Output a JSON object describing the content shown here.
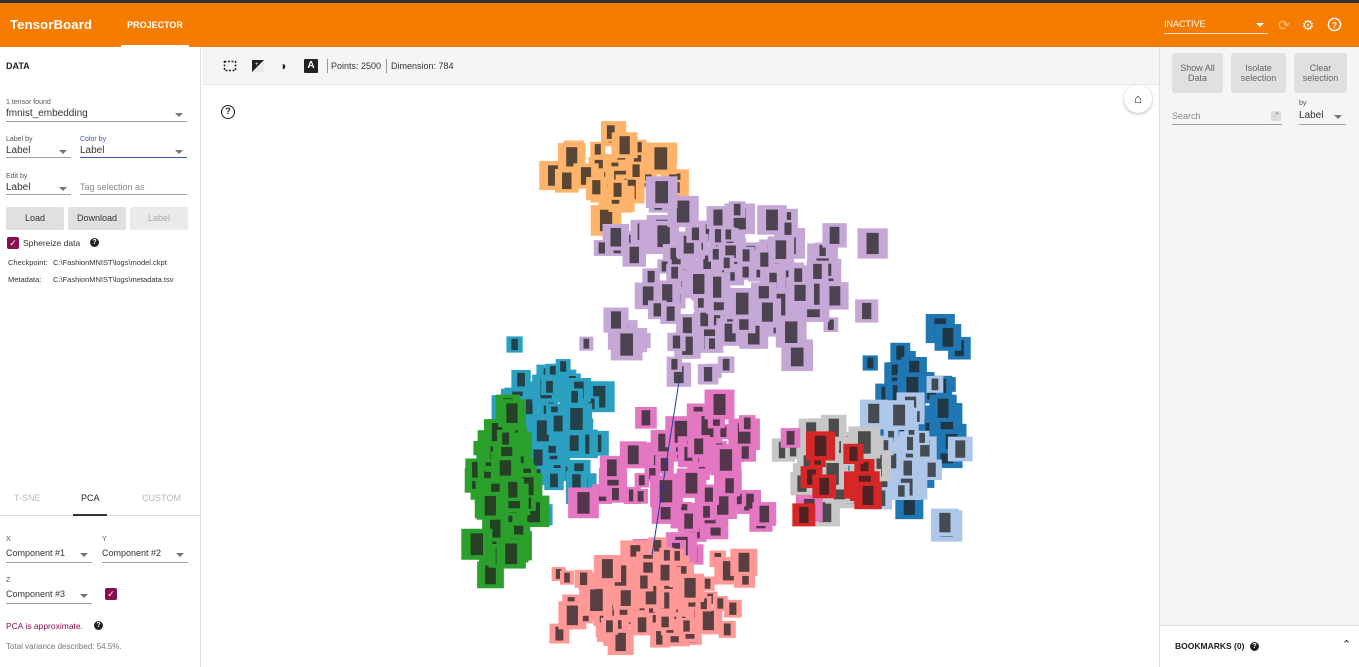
{
  "header": {
    "brand": "TensorBoard",
    "tab_projector": "PROJECTOR",
    "run_status": "INACTIVE",
    "refresh_icon": "refresh-icon",
    "settings_icon": "gear-icon",
    "help_icon": "help-icon",
    "accent_color": "#f57c00"
  },
  "data_panel": {
    "title": "DATA",
    "tensor_found_label": "1 tensor found",
    "tensor_value": "fmnist_embedding",
    "label_by_label": "Label by",
    "label_by_value": "Label",
    "color_by_label": "Color by",
    "color_by_value": "Label",
    "edit_by_label": "Edit by",
    "edit_by_value": "Label",
    "tag_placeholder": "Tag selection as",
    "load_button": "Load",
    "download_button": "Download",
    "label_button": "Label",
    "sphereize_label": "Sphereize data",
    "sphereize_checked": true,
    "checkpoint_label": "Checkpoint:",
    "checkpoint_path": "C:\\FashionMNIST\\logs\\model.ckpt",
    "metadata_label": "Metadata:",
    "metadata_path": "C:\\FashionMNIST\\logs\\metadata.tsv"
  },
  "projection": {
    "tabs": [
      "T-SNE",
      "PCA",
      "CUSTOM"
    ],
    "active_tab": "PCA",
    "x_label": "X",
    "x_value": "Component #1",
    "y_label": "Y",
    "y_value": "Component #2",
    "z_label": "Z",
    "z_value": "Component #3",
    "z_enabled": true,
    "approx_note": "PCA is approximate.",
    "variance_note": "Total variance described: 54.5%."
  },
  "toolbar": {
    "select_icon": "selection-rect-icon",
    "night_icon": "night-mode-icon",
    "moon_icon": "moon-icon",
    "label_icon": "label-a-icon",
    "points_text": "Points: 2500",
    "dimension_text": "Dimension: 784"
  },
  "inspector": {
    "show_all": "Show All Data",
    "isolate": "Isolate selection",
    "clear": "Clear selection",
    "search_placeholder": "Search",
    "by_label": "by",
    "by_value": "Label",
    "bookmarks": "BOOKMARKS (0)"
  },
  "colors": {
    "trousers": "#ffb36b",
    "dress": "#c5a8d6",
    "coat": "#1f77b4",
    "shirt": "#aec7e8",
    "sneaker": "#2ca0c0",
    "ankle_boot": "#ff9896",
    "sandal": "#2ca02c",
    "bag": "#e377c2",
    "pullover": "#c7c7c7",
    "tshirt": "#d62728"
  }
}
